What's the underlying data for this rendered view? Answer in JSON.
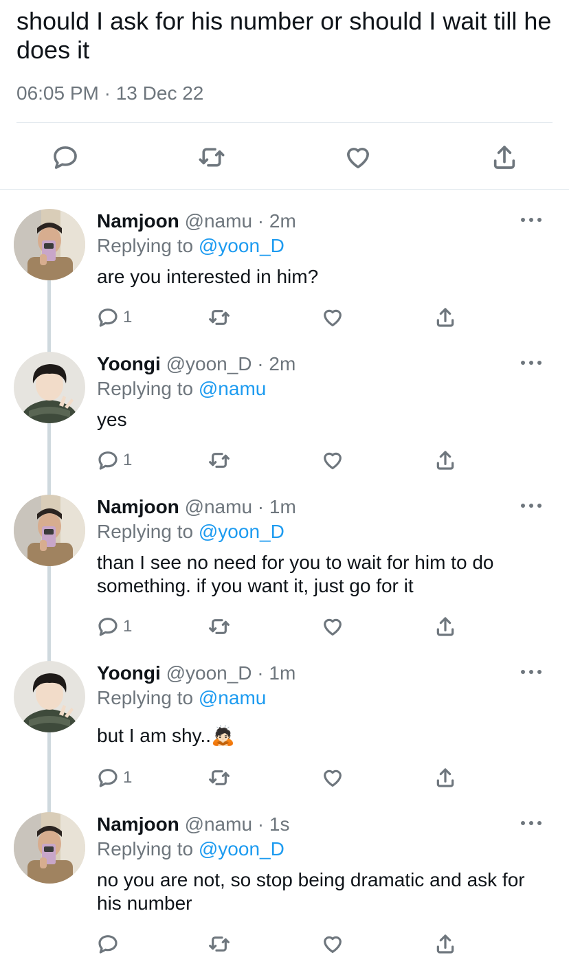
{
  "main_tweet": {
    "text": "should I ask for his number or should I wait till he does it",
    "meta": "06:05 PM · 13 Dec 22"
  },
  "replies": [
    {
      "name": "Namjoon",
      "handle_time": "@namu · 2m",
      "replying_prefix": "Replying to ",
      "replying_to": "@yoon_D",
      "text": "are you interested in him?",
      "reply_count": "1",
      "avatar": "namjoon-avatar"
    },
    {
      "name": "Yoongi",
      "handle_time": "@yoon_D · 2m",
      "replying_prefix": "Replying to ",
      "replying_to": "@namu",
      "text": "yes",
      "reply_count": "1",
      "avatar": "yoongi-avatar"
    },
    {
      "name": "Namjoon",
      "handle_time": "@namu · 1m",
      "replying_prefix": "Replying to ",
      "replying_to": "@yoon_D",
      "text": "than I see no need for you to wait for him to do something. if you want it, just go for it",
      "reply_count": "1",
      "avatar": "namjoon-avatar"
    },
    {
      "name": "Yoongi",
      "handle_time": "@yoon_D · 1m",
      "replying_prefix": "Replying to ",
      "replying_to": "@namu",
      "text": "but I am shy..🙇🏻",
      "reply_count": "1",
      "avatar": "yoongi-avatar"
    },
    {
      "name": "Namjoon",
      "handle_time": "@namu · 1s",
      "replying_prefix": "Replying to ",
      "replying_to": "@yoon_D",
      "text": "no you are not, so stop being dramatic and ask for his number",
      "reply_count": "",
      "avatar": "namjoon-avatar"
    }
  ],
  "colors": {
    "text": "#0f1419",
    "secondary": "#6e767d",
    "mention": "#1d9bf0",
    "thread_line": "#cfd9de"
  }
}
